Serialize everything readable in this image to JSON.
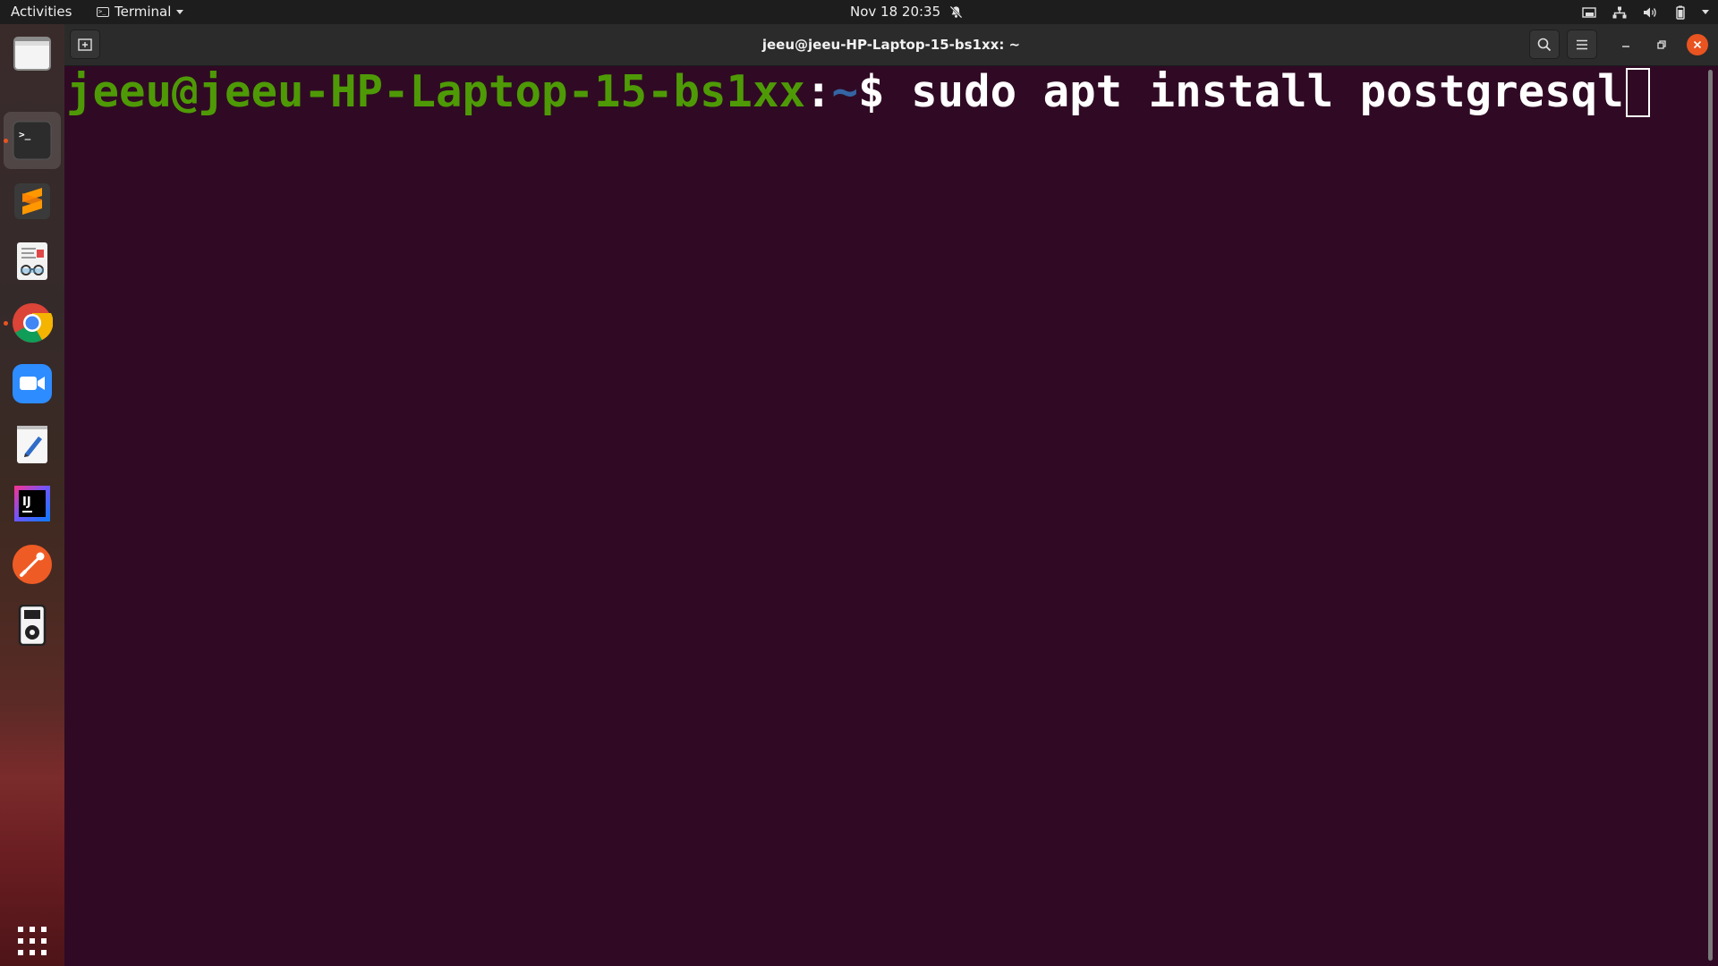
{
  "topbar": {
    "activities": "Activities",
    "app_menu": "Terminal",
    "clock": "Nov 18  20:35"
  },
  "dock": {
    "items": [
      {
        "name": "files-app",
        "running": false
      },
      {
        "name": "terminal-app",
        "running": true
      },
      {
        "name": "sublime-text-app",
        "running": false
      },
      {
        "name": "document-viewer-app",
        "running": false
      },
      {
        "name": "chrome-app",
        "running": true
      },
      {
        "name": "zoom-app",
        "running": false
      },
      {
        "name": "text-editor-app",
        "running": false
      },
      {
        "name": "intellij-idea-app",
        "running": false
      },
      {
        "name": "postman-app",
        "running": false
      },
      {
        "name": "ipod-music-app",
        "running": false
      }
    ],
    "show_apps_label": "Show Applications"
  },
  "window": {
    "title": "jeeu@jeeu-HP-Laptop-15-bs1xx: ~"
  },
  "terminal": {
    "user_host": "jeeu@jeeu-HP-Laptop-15-bs1xx",
    "colon": ":",
    "path": "~",
    "dollar": "$ ",
    "command": "sudo apt install postgresql"
  },
  "colors": {
    "terminal_bg": "#300a24",
    "prompt_user": "#4e9a06",
    "prompt_path": "#3465a4",
    "close_button": "#e95420"
  }
}
